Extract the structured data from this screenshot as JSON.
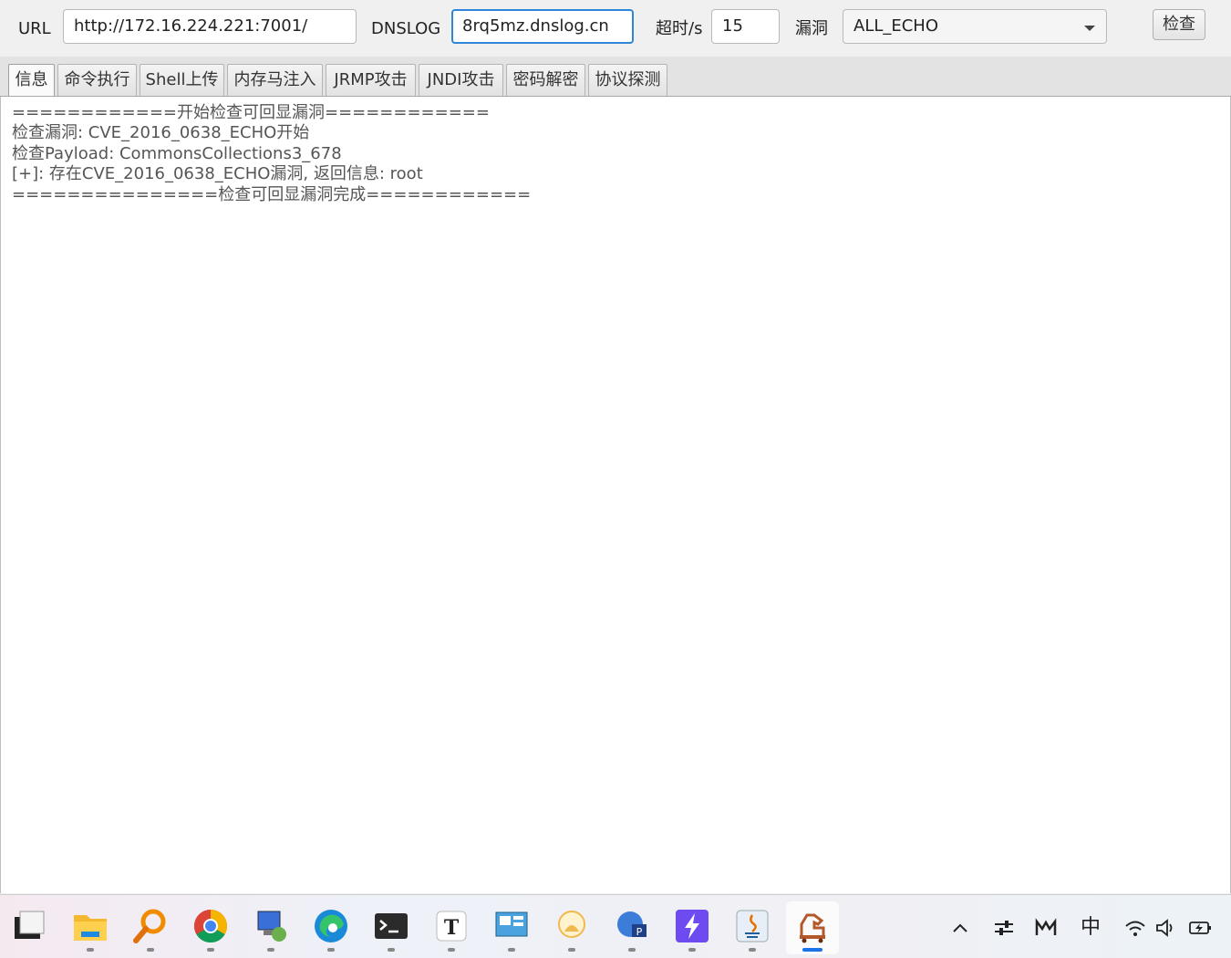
{
  "toolbar": {
    "url_label": "URL",
    "url_value": "http://172.16.224.221:7001/",
    "dnslog_label": "DNSLOG",
    "dnslog_value": "8rq5mz.dnslog.cn",
    "timeout_label": "超时/s",
    "timeout_value": "15",
    "vuln_label": "漏洞",
    "vuln_value": "ALL_ECHO",
    "check_button": "检查"
  },
  "tabs": [
    {
      "label": "信息",
      "active": true
    },
    {
      "label": "命令执行"
    },
    {
      "label": "Shell上传"
    },
    {
      "label": "内存马注入"
    },
    {
      "label": "JRMP攻击"
    },
    {
      "label": "JNDI攻击"
    },
    {
      "label": "密码解密"
    },
    {
      "label": "协议探测"
    }
  ],
  "output": {
    "lines": [
      "============开始检查可回显漏洞============",
      "检查漏洞: CVE_2016_0638_ECHO开始",
      "检查Payload: CommonsCollections3_678",
      "[+]: 存在CVE_2016_0638_ECHO漏洞, 返回信息: root",
      "===============检查可回显漏洞完成============"
    ]
  },
  "taskbar": {
    "apps": [
      "desktop-icon",
      "file-explorer-icon",
      "search-tool-icon",
      "chrome-icon",
      "remote-desktop-icon",
      "edge-icon",
      "terminal-icon",
      "typora-icon",
      "monitor-app-icon",
      "duck-app-icon",
      "network-app-icon",
      "lightning-app-icon",
      "java-icon",
      "trojan-horse-app-icon"
    ],
    "active_app": "trojan-horse-app-icon",
    "tray": {
      "ime": "中"
    }
  },
  "colors": {
    "focus_border": "#2f86d9",
    "active_indicator": "#1a73e8"
  }
}
